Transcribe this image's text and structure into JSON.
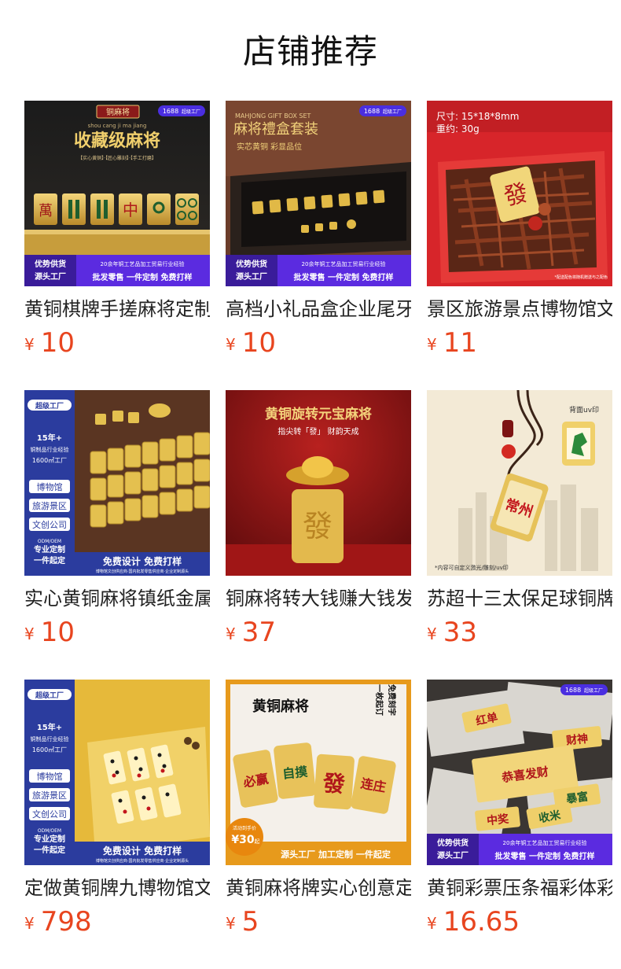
{
  "shop": {
    "title": "店铺推荐"
  },
  "colors": {
    "price": "#e8451f",
    "badge_blue": "#4a2ee0",
    "banner_purple": "#5b2be0"
  },
  "products": [
    {
      "name": "黄铜棋牌手搓麻将定制",
      "currency": "¥",
      "price": "10",
      "image": {
        "badge": "1688",
        "badge2": "超级工厂",
        "tag": "铜麻将",
        "pinyin": "shou  cang   ji   ma   jiang",
        "headline": "收藏级麻将",
        "sub": "【实心黄铜】·【匠心雕刻】·【手工打磨】",
        "strip_left_1": "优势供货",
        "strip_left_2": "源头工厂",
        "strip_top": "20余年铜工艺品加工贸易行业经验",
        "strip_bottom": "批发零售 一件定制 免费打样"
      }
    },
    {
      "name": "高档小礼品盒企业尾牙",
      "currency": "¥",
      "price": "10",
      "image": {
        "badge": "1688",
        "badge2": "超级工厂",
        "en": "MAHJONG GIFT BOX SET",
        "headline": "麻将禮盒套装",
        "sub": "实芯黄铜  彩显品位",
        "strip_left_1": "优势供货",
        "strip_left_2": "源头工厂",
        "strip_top": "20余年铜工艺品加工贸易行业经验",
        "strip_bottom": "批发零售 一件定制 免费打样"
      }
    },
    {
      "name": "景区旅游景点博物馆文创",
      "currency": "¥",
      "price": "11",
      "image": {
        "size": "尺寸: 15*18*8mm",
        "weight": "重约: 30g",
        "tile": "發",
        "note": "*配送配色将随机赠送与之配色"
      }
    },
    {
      "name": "实心黄铜麻将镇纸金属",
      "currency": "¥",
      "price": "10",
      "image": {
        "badge": "超级工厂",
        "years": "15年+",
        "exp": "铜制品行业经验",
        "area": "1600㎡工厂",
        "tag1": "博物馆",
        "tag2": "旅游景区",
        "tag3": "文创公司",
        "oem": "ODM/OEM",
        "custom1": "专业定制",
        "custom2": "一件起定",
        "banner": "免费设计 免费打样",
        "banner_sub": "博物馆文创供应商·国内批发零售供应商·企业定制源头"
      }
    },
    {
      "name": "铜麻将转大钱赚大钱发财",
      "currency": "¥",
      "price": "37",
      "image": {
        "headline": "黄铜旋转元宝麻将",
        "sub": "指尖转「發」 财韵天成",
        "tile": "發"
      }
    },
    {
      "name": "苏超十三太保足球铜牌",
      "currency": "¥",
      "price": "33",
      "image": {
        "back": "背面uv印",
        "tile": "常州",
        "note": "*内容可自定义激光/雕刻/uv印"
      }
    },
    {
      "name": "定做黄铜牌九博物馆文创",
      "currency": "¥",
      "price": "798",
      "image": {
        "badge": "超级工厂",
        "years": "15年+",
        "exp": "铜制品行业经验",
        "area": "1600㎡工厂",
        "tag1": "博物馆",
        "tag2": "旅游景区",
        "tag3": "文创公司",
        "oem": "ODM/OEM",
        "custom1": "专业定制",
        "custom2": "一件起定",
        "banner": "免费设计 免费打样",
        "banner_sub": "博物馆文创供应商·国内批发零售供应商·企业定制源头"
      }
    },
    {
      "name": "黄铜麻将牌实心创意定制",
      "currency": "¥",
      "price": "5",
      "image": {
        "headline": "黄铜麻将",
        "side1": "免费刻字",
        "side2": "一枚起订",
        "t1": "必赢",
        "t2": "自摸",
        "t3": "發",
        "t4": "连庄",
        "promo_small": "活动到手价",
        "promo_price": "¥30",
        "promo_unit": "起",
        "footer": "源头工厂  加工定制  一件起定"
      }
    },
    {
      "name": "黄铜彩票压条福彩体彩",
      "currency": "¥",
      "price": "16.65",
      "image": {
        "badge": "1688",
        "badge2": "超级工厂",
        "p1": "红单",
        "p2": "财神",
        "p3": "暴富",
        "p4": "收米",
        "p5": "中奖",
        "p6": "恭喜发财",
        "strip_left_1": "优势供货",
        "strip_left_2": "源头工厂",
        "strip_top": "20余年铜工艺品加工贸易行业经验",
        "strip_bottom": "批发零售 一件定制 免费打样"
      }
    }
  ]
}
